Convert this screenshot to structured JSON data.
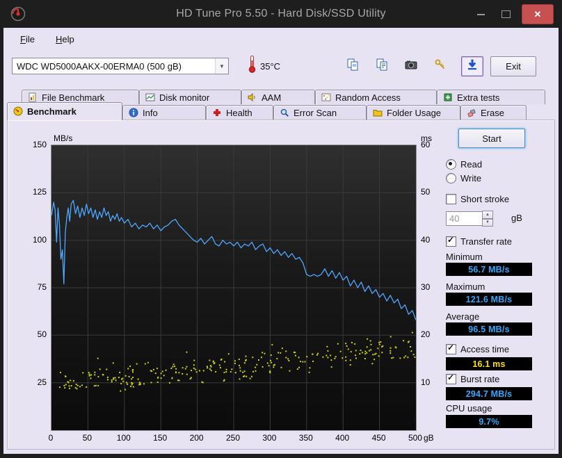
{
  "window": {
    "title": "HD Tune Pro 5.50 - Hard Disk/SSD Utility"
  },
  "menu": {
    "items": [
      {
        "id": "file",
        "label": "File"
      },
      {
        "id": "help",
        "label": "Help"
      }
    ]
  },
  "toolbar": {
    "drive_selected": "WDC WD5000AAKX-00ERMA0 (500 gB)",
    "temperature": "35°C",
    "buttons": [
      {
        "id": "copy-image",
        "icon": "copy-image-icon",
        "highlighted": false
      },
      {
        "id": "copy-text",
        "icon": "copy-text-icon",
        "highlighted": false
      },
      {
        "id": "screenshot",
        "icon": "camera-icon",
        "highlighted": false
      },
      {
        "id": "registration",
        "icon": "keys-icon",
        "highlighted": false
      },
      {
        "id": "save-results",
        "icon": "download-icon",
        "highlighted": true
      }
    ],
    "exit_label": "Exit"
  },
  "tabs": {
    "row1": [
      {
        "label": "File Benchmark",
        "icon": "file-benchmark-icon"
      },
      {
        "label": "Disk monitor",
        "icon": "disk-monitor-icon"
      },
      {
        "label": "AAM",
        "icon": "aam-icon"
      },
      {
        "label": "Random Access",
        "icon": "random-access-icon"
      },
      {
        "label": "Extra tests",
        "icon": "extra-tests-icon"
      }
    ],
    "row2": [
      {
        "label": "Benchmark",
        "icon": "benchmark-icon",
        "active": true
      },
      {
        "label": "Info",
        "icon": "info-icon"
      },
      {
        "label": "Health",
        "icon": "health-icon"
      },
      {
        "label": "Error Scan",
        "icon": "error-scan-icon"
      },
      {
        "label": "Folder Usage",
        "icon": "folder-usage-icon"
      },
      {
        "label": "Erase",
        "icon": "erase-icon"
      }
    ]
  },
  "panel": {
    "start_label": "Start",
    "read_label": "Read",
    "read_selected": true,
    "write_label": "Write",
    "write_selected": false,
    "short_stroke_label": "Short stroke",
    "short_stroke_checked": false,
    "short_stroke_value": "40",
    "short_stroke_unit": "gB",
    "transfer_rate_label": "Transfer rate",
    "transfer_rate_checked": true,
    "minimum_label": "Minimum",
    "minimum_value": "56.7 MB/s",
    "maximum_label": "Maximum",
    "maximum_value": "121.6 MB/s",
    "average_label": "Average",
    "average_value": "96.5 MB/s",
    "access_time_label": "Access time",
    "access_time_checked": true,
    "access_time_value": "16.1 ms",
    "burst_rate_label": "Burst rate",
    "burst_rate_checked": true,
    "burst_rate_value": "294.7 MB/s",
    "cpu_usage_label": "CPU usage",
    "cpu_usage_value": "9.7%"
  },
  "chart_data": {
    "type": "line",
    "title": "HD Tune benchmark: transfer rate (line) and access time (scatter)",
    "x_unit": "gB",
    "x_range": [
      0,
      500
    ],
    "x_ticks": [
      0,
      50,
      100,
      150,
      200,
      250,
      300,
      350,
      400,
      450,
      500
    ],
    "left_axis": {
      "label": "MB/s",
      "range": [
        0,
        150
      ],
      "ticks": [
        25,
        50,
        75,
        100,
        125,
        150
      ]
    },
    "right_axis": {
      "label": "ms",
      "range": [
        0,
        60
      ],
      "ticks": [
        10,
        20,
        30,
        40,
        50,
        60
      ]
    },
    "grid": true,
    "series": [
      {
        "name": "Transfer rate",
        "type": "line",
        "axis": "left",
        "color": "#4fa8ff",
        "points": [
          [
            0,
            113
          ],
          [
            3,
            120
          ],
          [
            5,
            116
          ],
          [
            7,
            99
          ],
          [
            9,
            117
          ],
          [
            11,
            108
          ],
          [
            13,
            90
          ],
          [
            15,
            95
          ],
          [
            17,
            77
          ],
          [
            19,
            104
          ],
          [
            21,
            112
          ],
          [
            23,
            117
          ],
          [
            25,
            110
          ],
          [
            27,
            119
          ],
          [
            30,
            121
          ],
          [
            33,
            114
          ],
          [
            36,
            118
          ],
          [
            39,
            112
          ],
          [
            42,
            117
          ],
          [
            45,
            113
          ],
          [
            48,
            119
          ],
          [
            51,
            114
          ],
          [
            54,
            117
          ],
          [
            57,
            112
          ],
          [
            60,
            116
          ],
          [
            63,
            111
          ],
          [
            66,
            115
          ],
          [
            69,
            112
          ],
          [
            72,
            117
          ],
          [
            75,
            113
          ],
          [
            78,
            115
          ],
          [
            81,
            110
          ],
          [
            84,
            113
          ],
          [
            87,
            111
          ],
          [
            90,
            114
          ],
          [
            93,
            110
          ],
          [
            96,
            112
          ],
          [
            100,
            109
          ],
          [
            105,
            111
          ],
          [
            110,
            107
          ],
          [
            115,
            109
          ],
          [
            120,
            106
          ],
          [
            125,
            108
          ],
          [
            130,
            107
          ],
          [
            135,
            109
          ],
          [
            140,
            106
          ],
          [
            145,
            108
          ],
          [
            150,
            105
          ],
          [
            155,
            107
          ],
          [
            160,
            108
          ],
          [
            165,
            110
          ],
          [
            170,
            111
          ],
          [
            175,
            108
          ],
          [
            180,
            106
          ],
          [
            185,
            104
          ],
          [
            190,
            102
          ],
          [
            195,
            100
          ],
          [
            200,
            99
          ],
          [
            205,
            101
          ],
          [
            210,
            98
          ],
          [
            215,
            100
          ],
          [
            220,
            102
          ],
          [
            225,
            98
          ],
          [
            230,
            97
          ],
          [
            235,
            100
          ],
          [
            240,
            98
          ],
          [
            245,
            99
          ],
          [
            250,
            97
          ],
          [
            255,
            99
          ],
          [
            260,
            96
          ],
          [
            265,
            98
          ],
          [
            270,
            97
          ],
          [
            275,
            99
          ],
          [
            280,
            95
          ],
          [
            285,
            97
          ],
          [
            290,
            98
          ],
          [
            295,
            94
          ],
          [
            300,
            96
          ],
          [
            305,
            93
          ],
          [
            310,
            95
          ],
          [
            315,
            92
          ],
          [
            320,
            94
          ],
          [
            325,
            91
          ],
          [
            330,
            93
          ],
          [
            335,
            90
          ],
          [
            340,
            91
          ],
          [
            345,
            88
          ],
          [
            350,
            82
          ],
          [
            355,
            81
          ],
          [
            360,
            82
          ],
          [
            365,
            81
          ],
          [
            370,
            82
          ],
          [
            375,
            85
          ],
          [
            380,
            81
          ],
          [
            385,
            84
          ],
          [
            390,
            80
          ],
          [
            395,
            83
          ],
          [
            400,
            79
          ],
          [
            405,
            81
          ],
          [
            410,
            76
          ],
          [
            415,
            79
          ],
          [
            420,
            75
          ],
          [
            425,
            78
          ],
          [
            430,
            73
          ],
          [
            435,
            76
          ],
          [
            440,
            72
          ],
          [
            445,
            74
          ],
          [
            450,
            70
          ],
          [
            455,
            72
          ],
          [
            460,
            68
          ],
          [
            465,
            71
          ],
          [
            470,
            67
          ],
          [
            475,
            69
          ],
          [
            480,
            64
          ],
          [
            485,
            66
          ],
          [
            490,
            61
          ],
          [
            495,
            63
          ],
          [
            500,
            58
          ]
        ]
      },
      {
        "name": "Access time",
        "type": "scatter",
        "axis": "right",
        "color": "#cdd112",
        "generator": {
          "count": 290,
          "seed": 20,
          "x_min": 8,
          "x_max": 500,
          "trend": [
            [
              0,
              9.5
            ],
            [
              40,
              10.2
            ],
            [
              120,
              11.5
            ],
            [
              220,
              13.0
            ],
            [
              320,
              14.5
            ],
            [
              420,
              16.2
            ],
            [
              500,
              17.8
            ]
          ],
          "jitter": 3.2,
          "outlier_chance": 0.07,
          "outlier_extra": 4.5,
          "y_clamp": [
            6.4,
            22.5
          ]
        }
      }
    ],
    "stats": {
      "minimum": "56.7 MB/s",
      "maximum": "121.6 MB/s",
      "average": "96.5 MB/s",
      "access_time": "16.1 ms",
      "burst_rate": "294.7 MB/s",
      "cpu_usage": "9.7%"
    }
  }
}
